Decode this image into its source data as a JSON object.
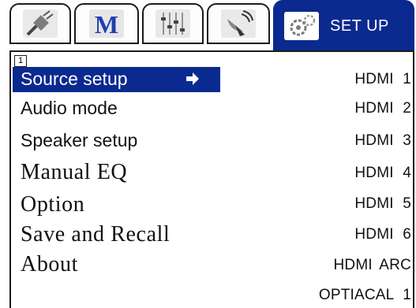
{
  "tabs": [
    {
      "icon": "plug-icon",
      "label": ""
    },
    {
      "icon": "m-logo-icon",
      "label": ""
    },
    {
      "icon": "mixer-icon",
      "label": ""
    },
    {
      "icon": "satellite-dish-icon",
      "label": ""
    },
    {
      "icon": "gears-icon",
      "label": "SET UP",
      "active": true
    }
  ],
  "page_indicator": "1",
  "menu": {
    "selected_index": 0,
    "items": [
      {
        "label": "Source setup",
        "has_arrow": true
      },
      {
        "label": "Audio mode"
      },
      {
        "label": "Speaker setup"
      },
      {
        "label": "Manual EQ"
      },
      {
        "label": "Option"
      },
      {
        "label": "Save and Recall"
      },
      {
        "label": "About"
      }
    ]
  },
  "inputs": [
    "HDMI  1",
    "HDMI  2",
    "HDMI  3",
    "HDMI  4",
    "HDMI  5",
    "HDMI  6",
    "HDMI  ARC",
    "OPTIACAL  1"
  ],
  "colors": {
    "accent": "#0b2a8f",
    "text": "#111111",
    "background": "#ffffff"
  }
}
